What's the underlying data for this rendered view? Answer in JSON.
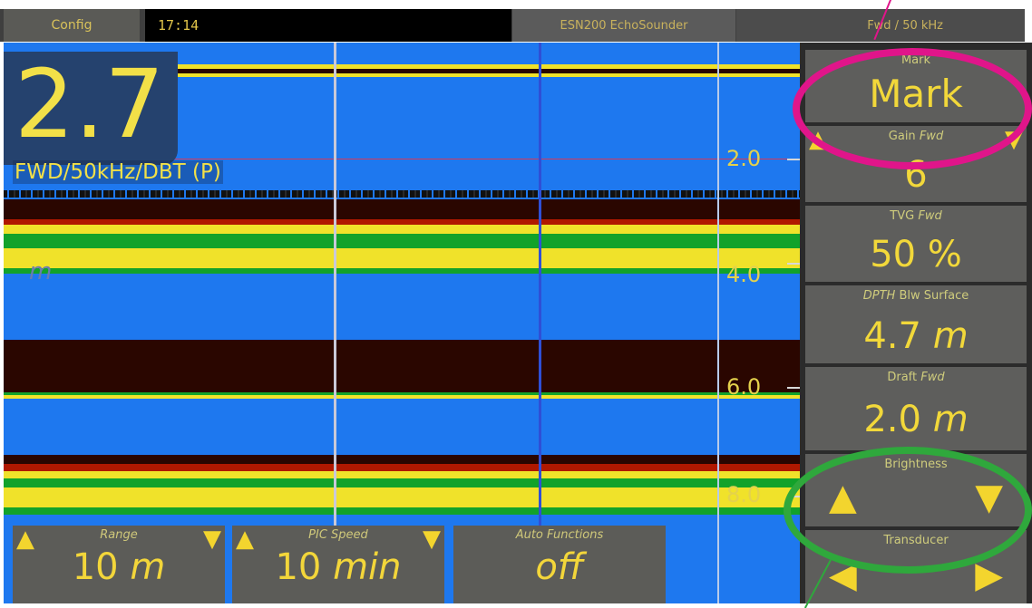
{
  "topbar": {
    "config_label": "Config",
    "clock": "17:14",
    "title": "ESN200 EchoSounder",
    "frequency": "Fwd / 50 kHz"
  },
  "echogram": {
    "depth_value": "2.7",
    "depth_caption": "FWD/50kHz/DBT (P)",
    "unit_ghost": "m",
    "scale_labels": [
      "2.0",
      "4.0",
      "6.0",
      "8.0"
    ]
  },
  "right_panel": {
    "mark": {
      "label": "Mark",
      "value": "Mark"
    },
    "gain": {
      "label_plain": "Gain",
      "label_italic": "Fwd",
      "value": "6"
    },
    "tvg": {
      "label_plain": "TVG",
      "label_italic": "Fwd",
      "value": "50 %"
    },
    "dpth": {
      "label_italic": "DPTH",
      "label_plain": "Blw Surface",
      "value_num": "4.7",
      "value_unit": "m"
    },
    "draft": {
      "label_plain": "Draft",
      "label_italic": "Fwd",
      "value_num": "2.0",
      "value_unit": "m"
    },
    "brightness": {
      "label": "Brightness"
    },
    "transducer": {
      "label": "Transducer"
    }
  },
  "bottom_controls": {
    "range": {
      "label": "Range",
      "value_num": "10",
      "value_unit": "m"
    },
    "pic_speed": {
      "label": "PIC Speed",
      "value_num": "10",
      "value_unit": "min"
    },
    "auto_functions": {
      "label": "Auto Functions",
      "value": "off"
    }
  },
  "icons": {
    "up": "▲",
    "down": "▼",
    "left": "◀",
    "right": "▶"
  },
  "colors": {
    "accent_yellow": "#f2d83a",
    "water_blue": "#1e78ef",
    "annotation_pink": "#e0158a",
    "annotation_green": "#2fa83c"
  }
}
